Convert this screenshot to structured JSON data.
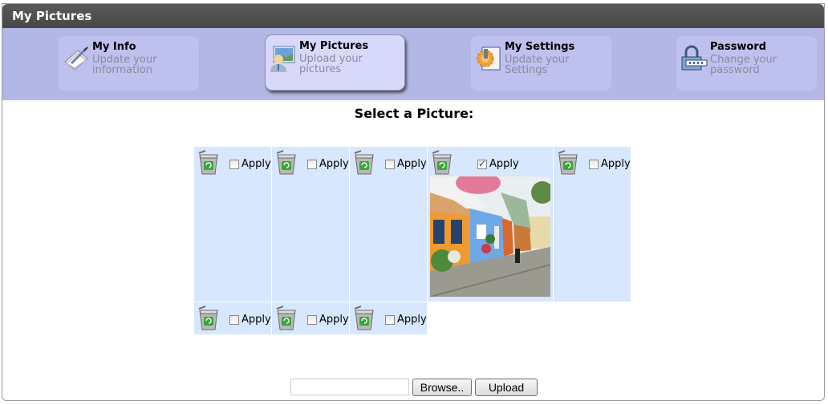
{
  "window": {
    "title": "My Pictures"
  },
  "nav": {
    "items": [
      {
        "label": "My Info",
        "desc": "Update your information",
        "icon": "edit-document-icon",
        "active": false
      },
      {
        "label": "My Pictures",
        "desc": "Upload your pictures",
        "icon": "user-picture-icon",
        "active": true
      },
      {
        "label": "My Settings",
        "desc": "Update your Settings",
        "icon": "settings-gear-icon",
        "active": false
      },
      {
        "label": "Password",
        "desc": "Change your password",
        "icon": "padlock-password-icon",
        "active": false
      }
    ]
  },
  "main": {
    "heading": "Select a Picture:",
    "apply_label": "Apply",
    "pictures": [
      {
        "checked": false,
        "has_image": false
      },
      {
        "checked": false,
        "has_image": false
      },
      {
        "checked": false,
        "has_image": false
      },
      {
        "checked": true,
        "has_image": true,
        "image_desc": "Colorful houses on a cobblestone street"
      },
      {
        "checked": false,
        "has_image": false
      },
      {
        "checked": false,
        "has_image": false
      },
      {
        "checked": false,
        "has_image": false
      },
      {
        "checked": false,
        "has_image": false
      }
    ]
  },
  "upload": {
    "file_value": "",
    "browse_label": "Browse..",
    "upload_label": "Upload"
  }
}
